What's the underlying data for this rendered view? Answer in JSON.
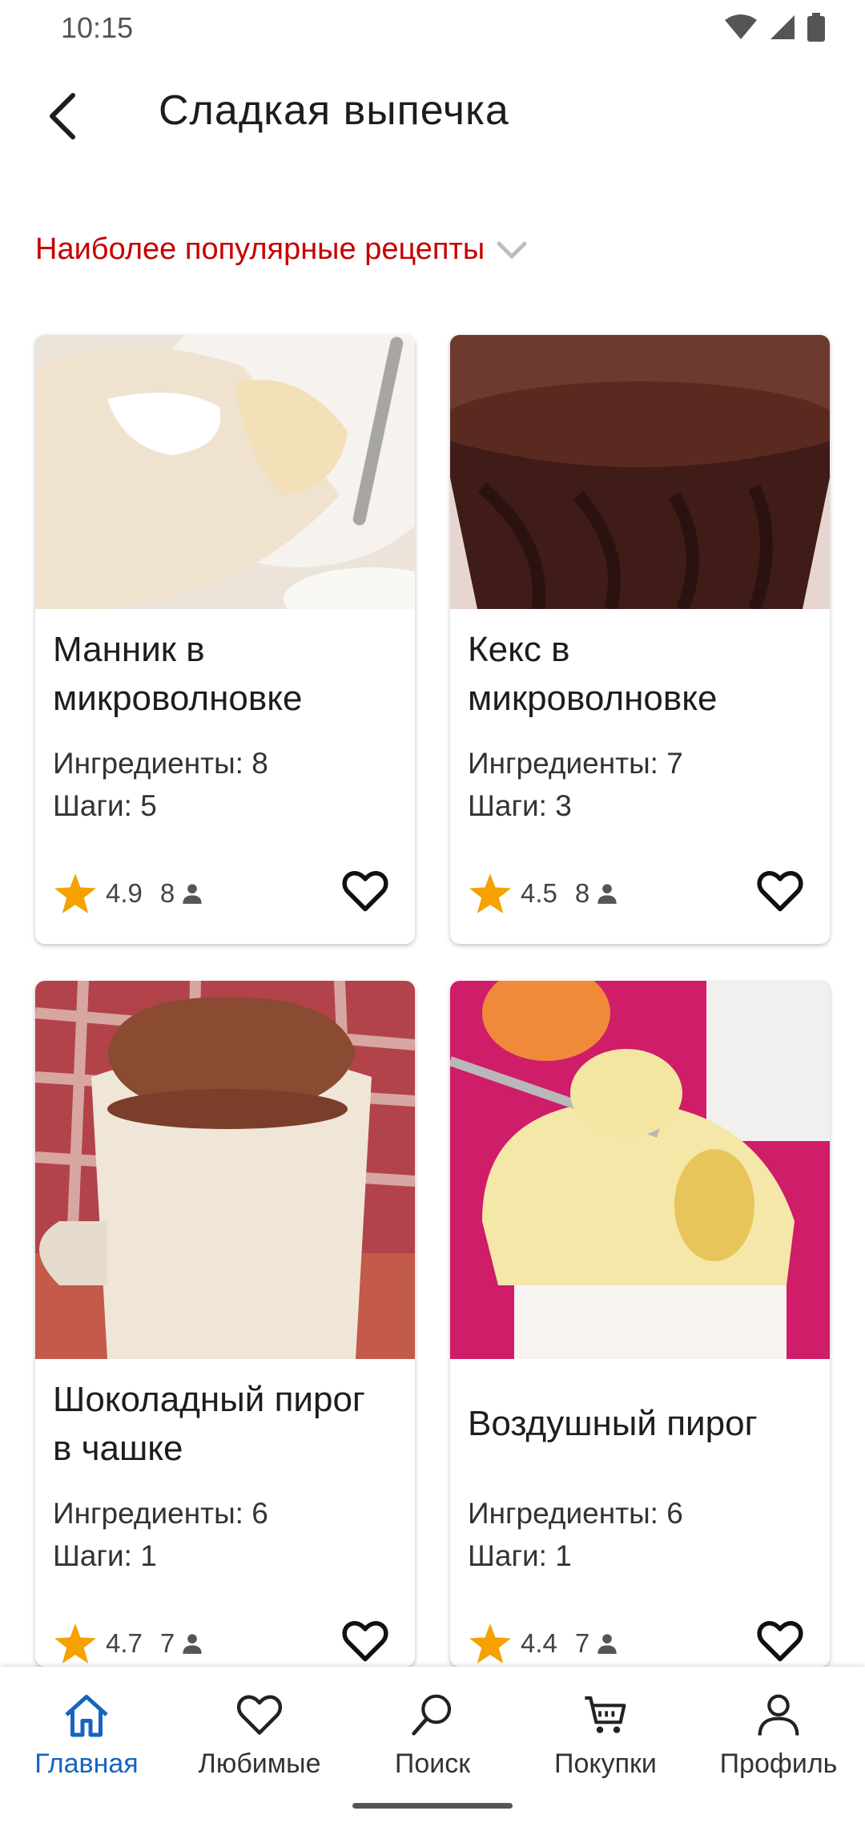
{
  "status": {
    "time": "10:15"
  },
  "header": {
    "title": "Сладкая  выпечка"
  },
  "section": {
    "label": "Наиболее популярные рецепты"
  },
  "recipes": [
    {
      "name_line1": "Манник в",
      "name_line2": "микроволновке",
      "ingredients": "Ингредиенты: 8",
      "steps": "Шаги: 5",
      "rating": "4.9",
      "people": "8",
      "image": "mannik-cake-photo"
    },
    {
      "name_line1": "Кекс в",
      "name_line2": "микроволновке",
      "ingredients": "Ингредиенты: 7",
      "steps": "Шаги: 3",
      "rating": "4.5",
      "people": "8",
      "image": "chocolate-muffin-photo"
    },
    {
      "name_line1": "Шоколадный пирог",
      "name_line2": "в чашке",
      "ingredients": "Ингредиенты: 6",
      "steps": "Шаги: 1",
      "rating": "4.7",
      "people": "7",
      "image": "mug-cake-photo"
    },
    {
      "name_line1": "Воздушный пирог",
      "name_line2": "",
      "ingredients": "Ингредиенты: 6",
      "steps": "Шаги: 1",
      "rating": "4.4",
      "people": "7",
      "image": "fluffy-pie-photo"
    }
  ],
  "nav": [
    {
      "label": "Главная",
      "icon": "home-icon",
      "active": true
    },
    {
      "label": "Любимые",
      "icon": "heart-icon"
    },
    {
      "label": "Поиск",
      "icon": "search-icon"
    },
    {
      "label": "Покупки",
      "icon": "cart-icon"
    },
    {
      "label": "Профиль",
      "icon": "profile-icon"
    }
  ],
  "colors": {
    "accent": "#c60000",
    "active_nav": "#1565c0",
    "star": "#f5a100"
  }
}
